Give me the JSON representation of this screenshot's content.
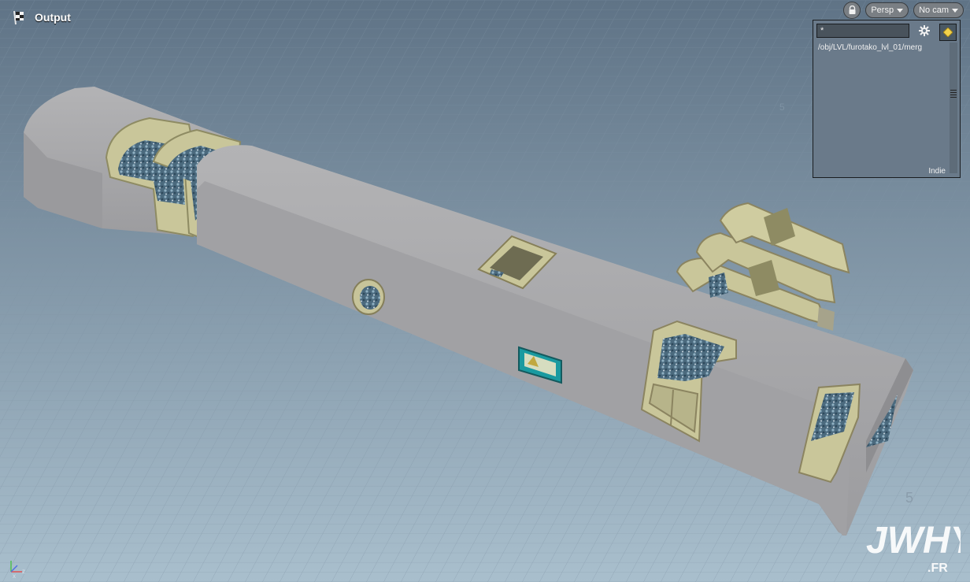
{
  "viewport": {
    "node_title": "Output",
    "view_menu": "Persp",
    "camera_menu": "No cam",
    "grid_labels": [
      "5",
      "5"
    ],
    "background_top": "#5f7386",
    "background_bottom": "#a9bfcd"
  },
  "display_panel": {
    "filter_value": "*",
    "path": "/obj/LVL/furotako_lvl_01/merg",
    "license": "Indie"
  },
  "gizmo": {
    "x_label": "x",
    "z_label": "z"
  },
  "watermark": {
    "text": "JWHY",
    "sub": ".FR"
  },
  "colors": {
    "hull": "#a4a4a6",
    "hull_shadow": "#8d8d90",
    "frame": "#cfcca0",
    "accent_teal": "#1a9aa0"
  }
}
